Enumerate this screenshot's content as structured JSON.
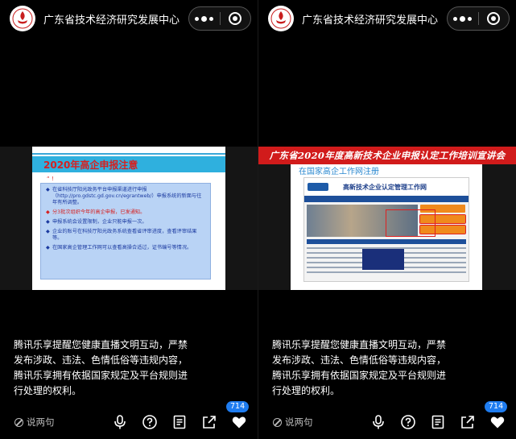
{
  "channel": {
    "title": "广东省技术经济研究发展中心"
  },
  "left_slide": {
    "title": "2020年高企申报注意",
    "marker": "“ !",
    "items": [
      {
        "text": "在省科技厅阳光政务平台申报渠道进行申报（http://pro.gdstc.gd.gov.cn/egrantweb/）申报系统的新面与往年有所调整。",
        "red": false
      },
      {
        "text": "分3批次组织今年的高企申报，已发通知。",
        "red": true
      },
      {
        "text": "申报系统会设置限制，企业只能申报一次。",
        "red": false
      },
      {
        "text": "企业的账号在科技厅阳光政务系统查看省评审进度，查看评审结果等。",
        "red": false
      },
      {
        "text": "在国家高企管理工作网可以查看高操合适过，证书编号等情况。",
        "red": false
      }
    ]
  },
  "right_slide": {
    "banner": "广东省2020年度高新技术企业申报认定工作培训宣讲会",
    "subtitle": "在国家高企工作网注册",
    "site_title": "高新技术企业认定管理工作网"
  },
  "notice": "腾讯乐享提醒您健康直播文明互动，严禁发布涉政、违法、色情低俗等违规内容，腾讯乐享拥有依据国家规定及平台规则进行处理的权利。",
  "bottom_bar": {
    "say_label": "说两句",
    "likes": "714"
  },
  "colors": {
    "accent_blue": "#1e7cf0",
    "banner_red": "#d11b1b",
    "slide_title_band": "#2fb0de"
  }
}
